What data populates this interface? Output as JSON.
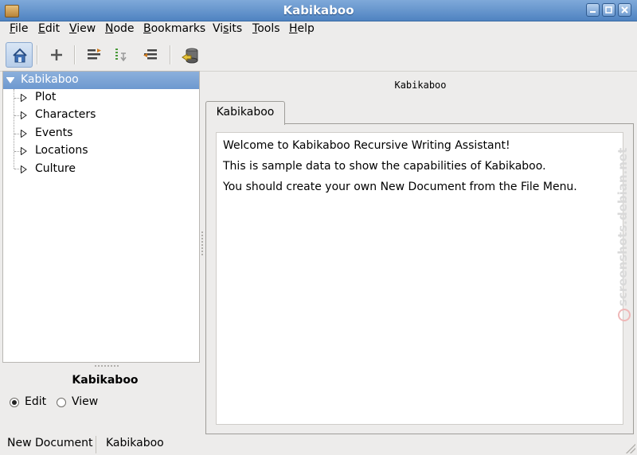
{
  "window": {
    "title": "Kabikaboo",
    "controls": [
      "minimize-icon",
      "maximize-icon",
      "close-icon"
    ]
  },
  "menu": {
    "items": [
      {
        "label": "File",
        "mnemonic": "F",
        "rest": "ile"
      },
      {
        "label": "Edit",
        "mnemonic": "E",
        "rest": "dit"
      },
      {
        "label": "View",
        "mnemonic": "V",
        "rest": "iew"
      },
      {
        "label": "Node",
        "mnemonic": "N",
        "rest": "ode"
      },
      {
        "label": "Bookmarks",
        "mnemonic": "B",
        "rest": "ookmarks"
      },
      {
        "label": "Visits",
        "pre": "Vi",
        "mnemonic": "s",
        "rest": "its"
      },
      {
        "label": "Tools",
        "mnemonic": "T",
        "rest": "ools"
      },
      {
        "label": "Help",
        "mnemonic": "H",
        "rest": "elp"
      }
    ]
  },
  "toolbar": {
    "buttons": [
      "home-icon",
      "add-icon",
      "indent-icon",
      "move-down-icon",
      "outdent-icon",
      "save-icon"
    ]
  },
  "tree": {
    "root": "Kabikaboo",
    "children": [
      "Plot",
      "Characters",
      "Events",
      "Locations",
      "Culture"
    ]
  },
  "node_panel": {
    "name": "Kabikaboo",
    "modes": [
      {
        "label": "Edit",
        "checked": true
      },
      {
        "label": "View",
        "checked": false
      }
    ]
  },
  "content": {
    "node_path": "Kabikaboo",
    "tab_label": "Kabikaboo",
    "lines": [
      "Welcome to Kabikaboo Recursive Writing Assistant!",
      "This is sample data to show the capabilities of Kabikaboo.",
      "You should create your own New Document from the File Menu."
    ]
  },
  "watermark": "screenshots.debian.net",
  "status": {
    "left": "New Document",
    "right": "Kabikaboo"
  }
}
